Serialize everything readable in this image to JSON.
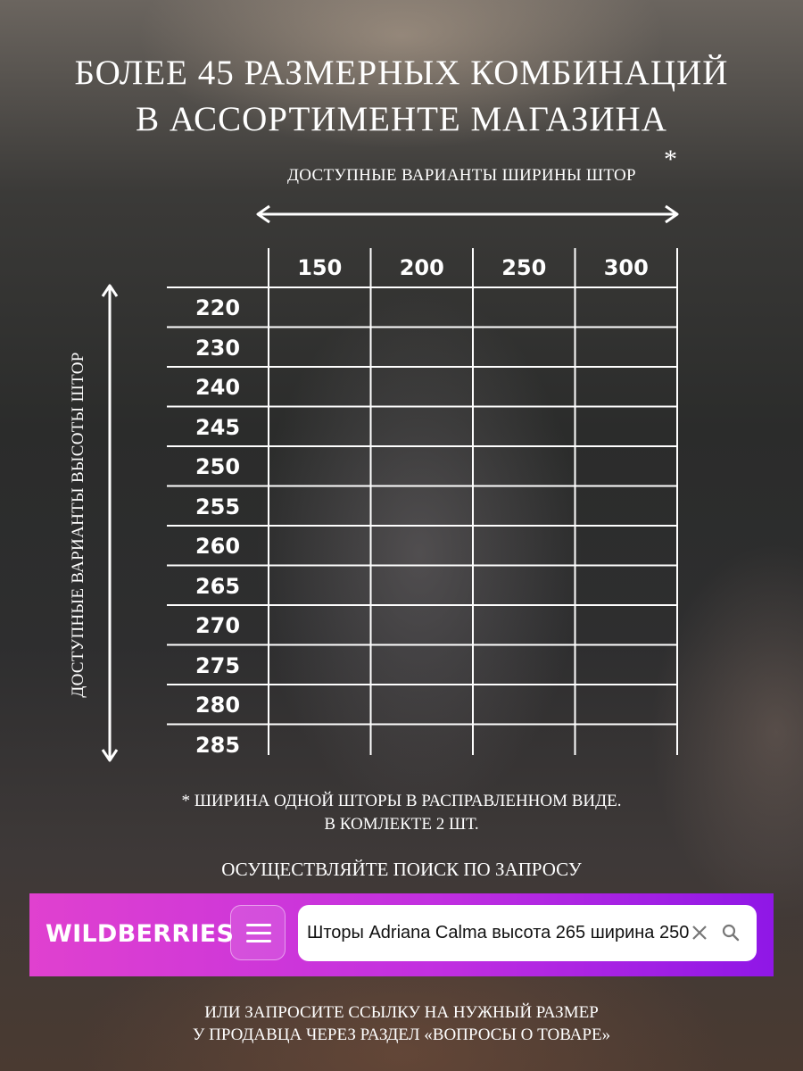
{
  "title_line1": "БОЛЕЕ 45 РАЗМЕРНЫХ КОМБИНАЦИЙ",
  "title_line2": "В АССОРТИМЕНТЕ МАГАЗИНА",
  "width_label": "ДОСТУПНЫЕ ВАРИАНТЫ ШИРИНЫ ШТОР",
  "width_asterisk": "*",
  "height_label": "ДОСТУПНЫЕ ВАРИАНТЫ ВЫСОТЫ ШТОР",
  "table": {
    "widths": [
      "150",
      "200",
      "250",
      "300"
    ],
    "heights": [
      "220",
      "230",
      "240",
      "245",
      "250",
      "255",
      "260",
      "265",
      "270",
      "275",
      "280",
      "285"
    ]
  },
  "footnote_line1": "*   ШИРИНА ОДНОЙ ШТОРЫ В РАСПРАВЛЕННОМ ВИДЕ.",
  "footnote_line2": "В КОМЛЕКТЕ 2 ШТ.",
  "search_hint": "ОСУЩЕСТВЛЯЙТЕ ПОИСК ПО ЗАПРОСУ",
  "search_bar": {
    "brand": "WILDBERRIES",
    "query": "Шторы Adriana Calma высота 265 ширина 250",
    "menu_icon": "hamburger-icon",
    "clear_icon": "close-icon",
    "search_icon": "search-icon",
    "gradient_start": "#e041cf",
    "gradient_end": "#8f17e6"
  },
  "bottom_line1": "ИЛИ ЗАПРОСИТЕ ССЫЛКУ НА НУЖНЫЙ РАЗМЕР",
  "bottom_line2": "У ПРОДАВЦА ЧЕРЕЗ РАЗДЕЛ «ВОПРОСЫ О ТОВАРЕ»"
}
